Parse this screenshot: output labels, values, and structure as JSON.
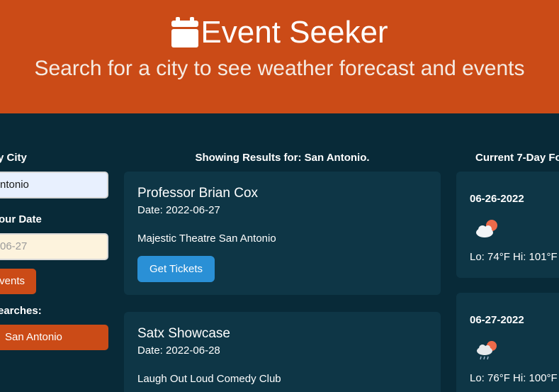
{
  "header": {
    "title": "Event Seeker",
    "subtitle": "Search for a city to see weather forecast and events",
    "icon": "calendar-icon"
  },
  "sidebar": {
    "city_label": "y City",
    "city_value": "ntonio",
    "date_label": "our Date",
    "date_placeholder": "06-27",
    "events_button": "vents",
    "history_label": "earches:",
    "history_items": [
      "San Antonio"
    ]
  },
  "results": {
    "heading": "Showing Results for: San Antonio.",
    "events": [
      {
        "name": "Professor Brian Cox",
        "date": "Date: 2022-06-27",
        "venue": "Majestic Theatre San Antonio",
        "button": "Get Tickets"
      },
      {
        "name": "Satx Showcase",
        "date": "Date: 2022-06-28",
        "venue": "Laugh Out Loud Comedy Club"
      }
    ]
  },
  "forecast": {
    "heading": "Current 7-Day Fo",
    "days": [
      {
        "date": "06-26-2022",
        "icon": "partly-cloudy-day-icon",
        "temps": "Lo: 74°F Hi: 101°F"
      },
      {
        "date": "06-27-2022",
        "icon": "rain-sun-icon",
        "temps": "Lo: 76°F Hi: 100°F"
      }
    ]
  },
  "colors": {
    "header_bg": "#cb4b17",
    "page_bg": "#082a38",
    "card_bg": "#0e3646",
    "button_blue": "#2a90d6",
    "accent_orange": "#cb4b17"
  }
}
